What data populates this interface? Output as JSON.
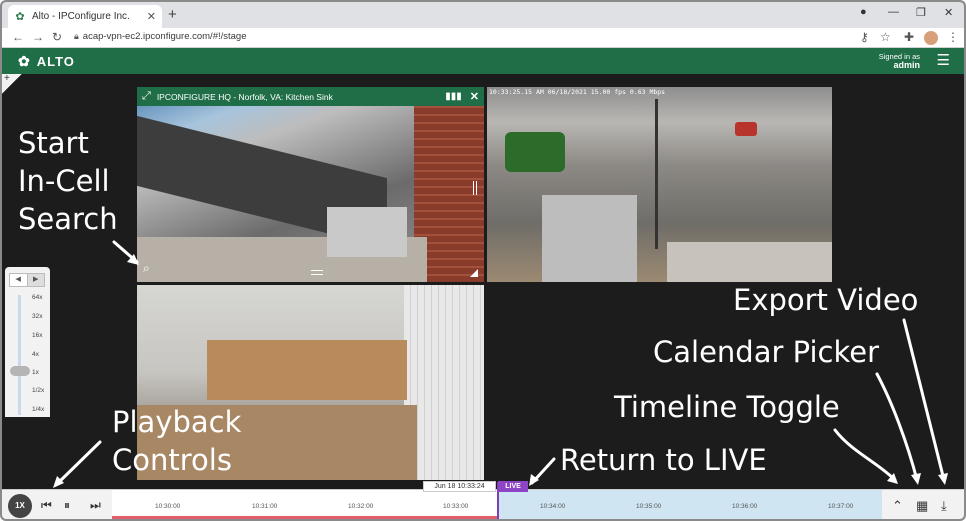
{
  "browser": {
    "tab_title": "Alto - IPConfigure Inc.",
    "url": "acap-vpn-ec2.ipconfigure.com/#!/stage"
  },
  "app": {
    "brand": "ALTO",
    "signed_in_label": "Signed in as",
    "username": "admin"
  },
  "cameras": [
    {
      "title": "IPCONFIGURE HQ - Norfolk, VA: Kitchen Sink"
    },
    {
      "osd": "10:33:25.15 AM 06/18/2021 15.00 fps 0.63 Mbps"
    }
  ],
  "speed_panel": {
    "labels": [
      "64x",
      "32x",
      "16x",
      "4x",
      "1x",
      "1/2x",
      "1/4x"
    ],
    "selected": "1x"
  },
  "playback": {
    "rate": "1X",
    "current_time": "Jun 18 10:33:24",
    "live_label": "LIVE"
  },
  "timeline": {
    "ticks": [
      "10:30:00",
      "10:31:00",
      "10:32:00",
      "10:33:00",
      "10:34:00",
      "10:35:00",
      "10:36:00",
      "10:37:00"
    ]
  },
  "annotations": {
    "start_search": [
      "Start",
      "In-Cell",
      "Search"
    ],
    "playback_controls": [
      "Playback",
      "Controls"
    ],
    "return_live": "Return to LIVE",
    "timeline_toggle": "Timeline Toggle",
    "calendar_picker": "Calendar Picker",
    "export_video": "Export Video"
  },
  "icons": {
    "brand_color": "#1f6e48",
    "live_color": "#8e44c7",
    "recording_color": "#e35d6a"
  }
}
